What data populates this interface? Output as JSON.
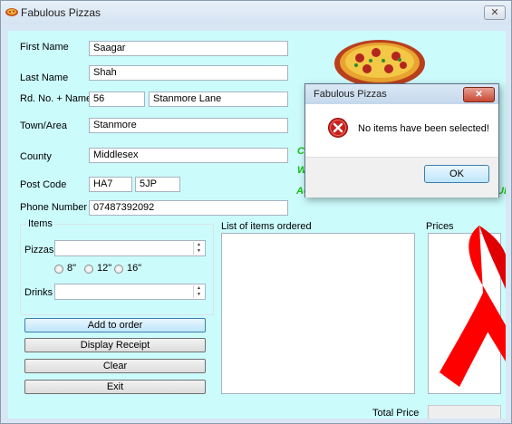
{
  "window": {
    "title": "Fabulous Pizzas",
    "close_glyph": "✕"
  },
  "form": {
    "first_name": {
      "label": "First Name",
      "value": "Saagar"
    },
    "last_name": {
      "label": "Last Name",
      "value": "Shah"
    },
    "road": {
      "label": "Rd. No. + Name",
      "number": "56",
      "name": "Stanmore Lane"
    },
    "town": {
      "label": "Town/Area",
      "value": "Stanmore"
    },
    "county": {
      "label": "County",
      "value": "Middlesex"
    },
    "postcode": {
      "label": "Post Code",
      "part1": "HA7",
      "part2": "5JP"
    },
    "phone": {
      "label": "Phone Number",
      "value": "07487392092"
    }
  },
  "items": {
    "group_title": "Items",
    "pizzas_label": "Pizzas",
    "pizzas_value": "",
    "sizes": [
      "8\"",
      "12\"",
      "16\""
    ],
    "drinks_label": "Drinks",
    "drinks_value": ""
  },
  "buttons": {
    "add": "Add to order",
    "receipt": "Display Receipt",
    "clear": "Clear",
    "exit": "Exit"
  },
  "lists": {
    "ordered_label": "List of items ordered",
    "prices_label": "Prices"
  },
  "total": {
    "label": "Total Price",
    "value": ""
  },
  "slogans": {
    "line1": "Co",
    "line2": "W",
    "line3": "Ac",
    "line3_end": "UP"
  },
  "dialog": {
    "title": "Fabulous Pizzas",
    "close_glyph": "✕",
    "message": "No items have been selected!",
    "ok": "OK",
    "icon": "error-icon"
  },
  "colors": {
    "client_bg": "#ccfbfc",
    "slogan": "#19c219",
    "ribbon": "#ff0000"
  }
}
